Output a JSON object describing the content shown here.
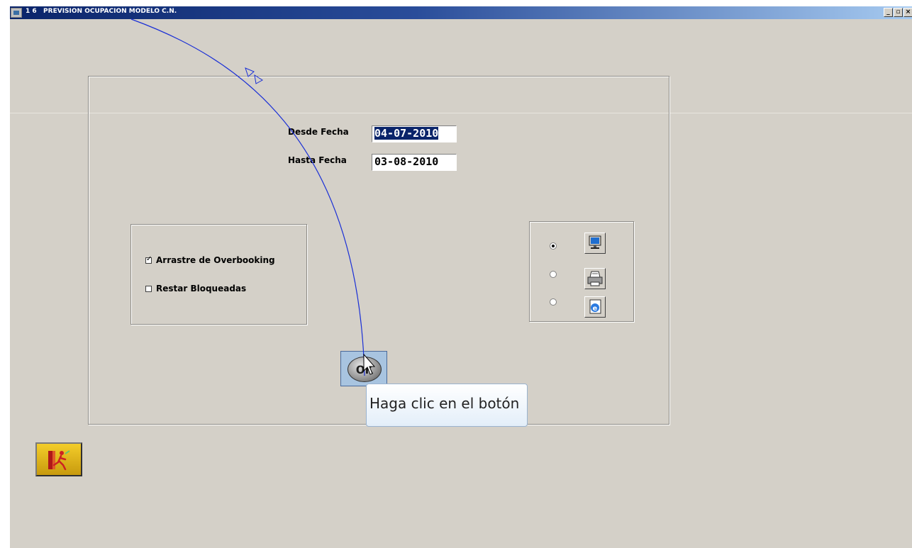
{
  "window": {
    "title": "1 6   PREVISION OCUPACION MODELO C.N.",
    "controls": {
      "minimize": "_",
      "restore": "▫",
      "close": "×"
    }
  },
  "form": {
    "desde_label": "Desde  Fecha",
    "desde_value": "04-07-2010",
    "hasta_label": "Hasta  Fecha",
    "hasta_value": "03-08-2010"
  },
  "options": {
    "arrastre_label": "Arrastre de Overbooking",
    "arrastre_checked": true,
    "restar_label": "Restar Bloqueadas",
    "restar_checked": false
  },
  "output": {
    "selected": "screen",
    "items": [
      {
        "icon": "monitor-icon",
        "selected": true
      },
      {
        "icon": "printer-icon",
        "selected": false
      },
      {
        "icon": "internet-explorer-icon",
        "selected": false
      }
    ]
  },
  "ok_button": {
    "label": "ok"
  },
  "exit_button": {
    "icon": "exit-door-icon"
  },
  "tooltip": {
    "text": "Haga clic en el botón"
  },
  "colors": {
    "window_bg": "#d4d0c8",
    "titlebar_start": "#0a246a",
    "titlebar_end": "#a6caf0",
    "selection": "#0a246a",
    "annotation_arrow": "#1a2fd6"
  }
}
